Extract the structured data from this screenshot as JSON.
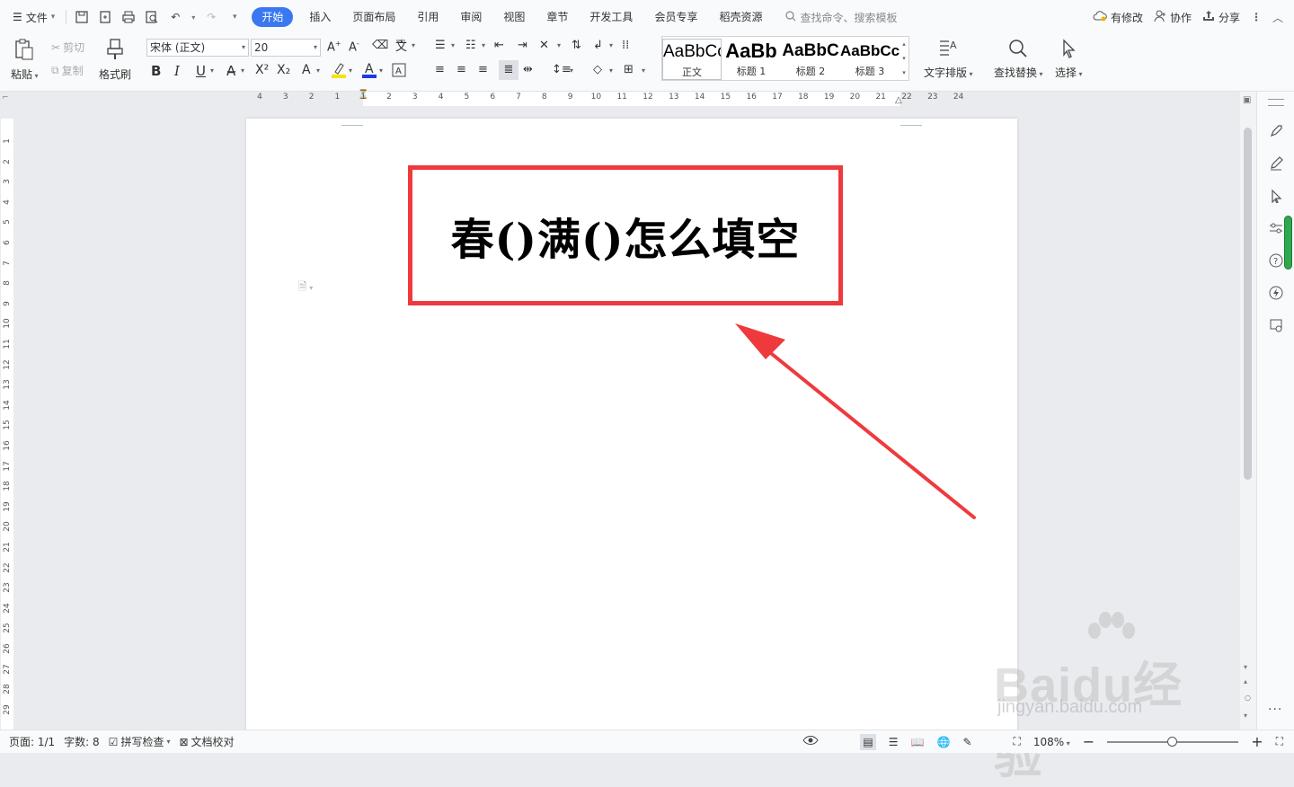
{
  "menubar": {
    "file_label": "文件",
    "tabs": [
      {
        "label": "开始",
        "active": true
      },
      {
        "label": "插入"
      },
      {
        "label": "页面布局"
      },
      {
        "label": "引用"
      },
      {
        "label": "审阅"
      },
      {
        "label": "视图"
      },
      {
        "label": "章节"
      },
      {
        "label": "开发工具"
      },
      {
        "label": "会员专享"
      },
      {
        "label": "稻壳资源"
      }
    ],
    "search_placeholder": "查找命令、搜索模板",
    "right": {
      "modified": "有修改",
      "collaborate": "协作",
      "share": "分享"
    }
  },
  "ribbon": {
    "paste": "粘贴",
    "cut": "剪切",
    "copy": "复制",
    "format_painter": "格式刷",
    "font_name": "宋体 (正文)",
    "font_size": "20",
    "styles": [
      {
        "sample": "AaBbCcDd",
        "name": "正文"
      },
      {
        "sample": "AaBb",
        "name": "标题 1"
      },
      {
        "sample": "AaBbC",
        "name": "标题 2"
      },
      {
        "sample": "AaBbCcI",
        "name": "标题 3"
      }
    ],
    "text_layout": "文字排版",
    "find_replace": "查找替换",
    "select": "选择"
  },
  "ruler": {
    "h_ticks": [
      "4",
      "3",
      "2",
      "1",
      "1",
      "2",
      "3",
      "4",
      "5",
      "6",
      "7",
      "8",
      "9",
      "10",
      "11",
      "12",
      "13",
      "14",
      "15",
      "16",
      "17",
      "18",
      "19",
      "20",
      "21",
      "22",
      "23",
      "24"
    ],
    "v_ticks": [
      "1",
      "2",
      "3",
      "4",
      "5",
      "6",
      "7",
      "8",
      "9",
      "10",
      "11",
      "12",
      "13",
      "14",
      "15",
      "16",
      "17",
      "18",
      "19",
      "20",
      "21",
      "22",
      "23",
      "24",
      "25",
      "26",
      "27",
      "28",
      "29"
    ]
  },
  "document": {
    "heading": "春()满()怎么填空"
  },
  "annotation": {
    "box_color": "#ef3a3d",
    "arrow_color": "#ef3a3d"
  },
  "statusbar": {
    "page": "页面: 1/1",
    "word_count": "字数: 8",
    "spell_check": "拼写检查",
    "doc_proof": "文档校对",
    "zoom": "108%",
    "zoom_level_fraction": 0.5
  },
  "watermark": {
    "logo": "Baidu经验",
    "url": "jingyan.baidu.com"
  }
}
